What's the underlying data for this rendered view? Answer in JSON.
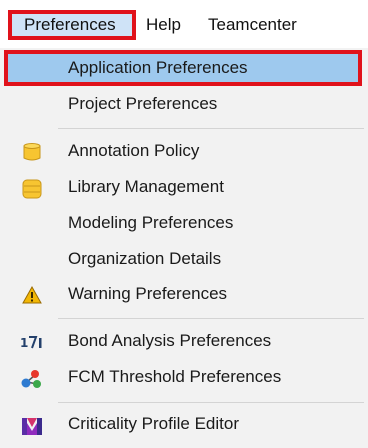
{
  "menubar": {
    "preferences_label": "Preferences",
    "help_label": "Help",
    "teamcenter_label": "Teamcenter"
  },
  "menu": {
    "items": [
      {
        "label": "Application Preferences",
        "icon": null,
        "selected": true
      },
      {
        "label": "Project Preferences",
        "icon": null
      },
      {
        "label": "Annotation Policy",
        "icon": "yellow-database-icon"
      },
      {
        "label": "Library Management",
        "icon": "yellow-stack-icon"
      },
      {
        "label": "Modeling Preferences",
        "icon": null
      },
      {
        "label": "Organization Details",
        "icon": null
      },
      {
        "label": "Warning Preferences",
        "icon": "warning-icon"
      },
      {
        "label": "Bond Analysis Preferences",
        "icon": "bond-analysis-icon"
      },
      {
        "label": "FCM Threshold Preferences",
        "icon": "fcm-nodes-icon"
      },
      {
        "label": "Criticality Profile Editor",
        "icon": "criticality-profile-icon"
      }
    ]
  },
  "colors": {
    "highlight_border": "#e0121b",
    "selected_bg": "#9ec9ee",
    "menubar_active_bg": "#cfe3f7",
    "menu_bg": "#f2f2f2"
  }
}
